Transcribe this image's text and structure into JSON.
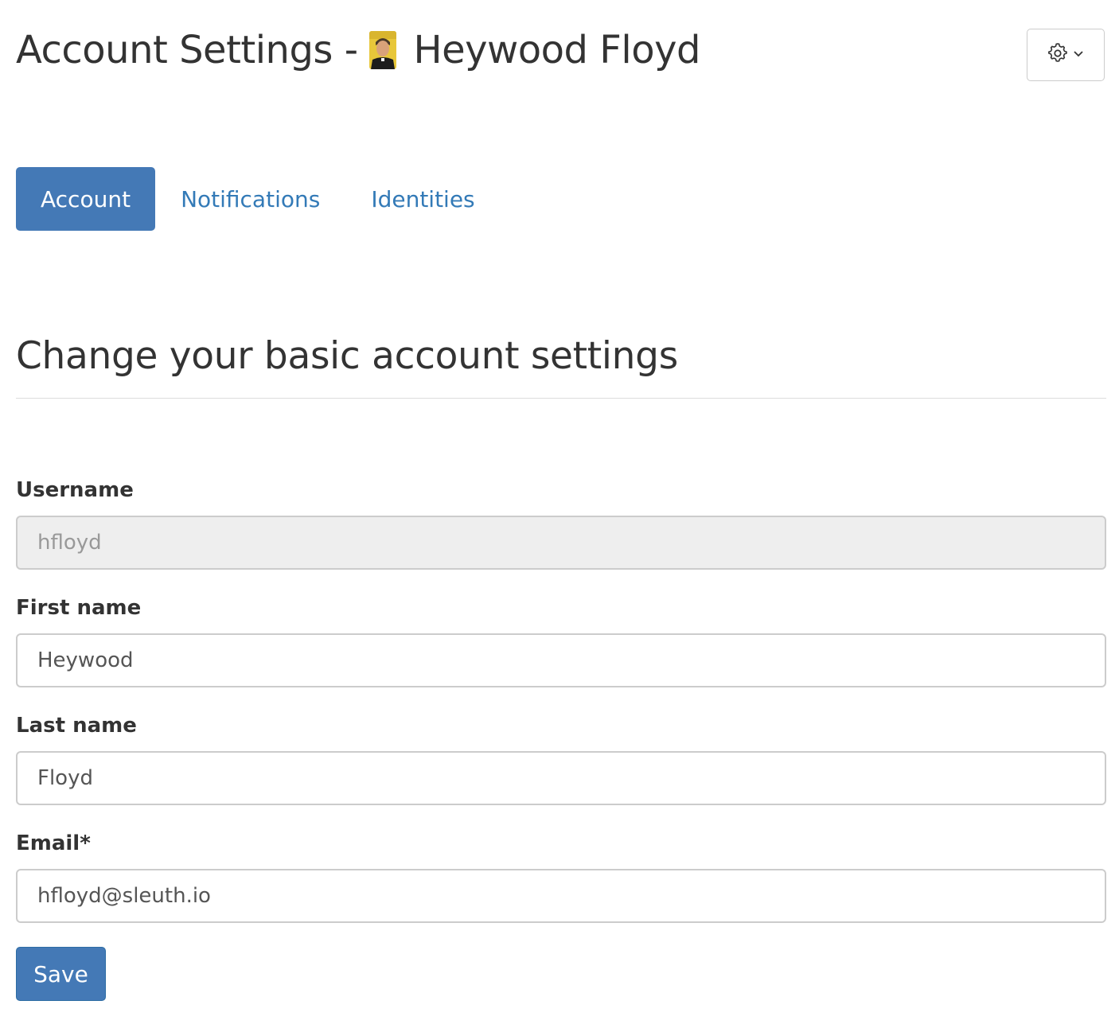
{
  "header": {
    "title_prefix": "Account Settings -",
    "user_name": "Heywood Floyd",
    "settings_icon": "gear-icon",
    "dropdown_icon": "chevron-down-icon"
  },
  "tabs": [
    {
      "label": "Account",
      "active": true
    },
    {
      "label": "Notifications",
      "active": false
    },
    {
      "label": "Identities",
      "active": false
    }
  ],
  "section": {
    "heading": "Change your basic account settings"
  },
  "form": {
    "username": {
      "label": "Username",
      "value": "hfloyd",
      "disabled": true
    },
    "first_name": {
      "label": "First name",
      "value": "Heywood"
    },
    "last_name": {
      "label": "Last name",
      "value": "Floyd"
    },
    "email": {
      "label": "Email*",
      "value": "hfloyd@sleuth.io"
    },
    "save_label": "Save"
  },
  "colors": {
    "primary": "#4479b6",
    "link": "#337ab7",
    "text": "#333333",
    "border": "#cccccc",
    "disabled_bg": "#eeeeee"
  }
}
